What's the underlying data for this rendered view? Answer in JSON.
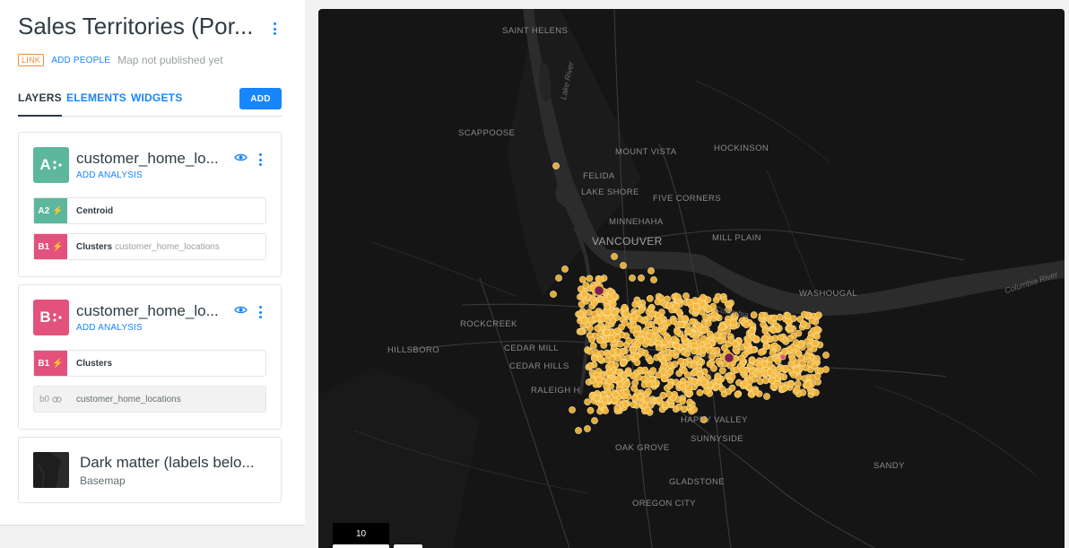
{
  "header": {
    "title": "Sales Territories (Por...",
    "link_badge": "LINK",
    "add_people": "ADD PEOPLE",
    "status": "Map not published yet"
  },
  "tabs": {
    "layers": "LAYERS",
    "elements": "ELEMENTS",
    "widgets": "WIDGETS",
    "add_button": "ADD"
  },
  "layers": [
    {
      "letter": "A",
      "name": "customer_home_lo...",
      "add_analysis": "ADD ANALYSIS",
      "color": "#5cb79d",
      "nodes": [
        {
          "id": "A2",
          "label": "Centroid",
          "source": "",
          "color": "#5cb79d"
        },
        {
          "id": "B1",
          "label": "Clusters",
          "source": "customer_home_locations",
          "color": "#e3517c"
        }
      ]
    },
    {
      "letter": "B",
      "name": "customer_home_lo...",
      "add_analysis": "ADD ANALYSIS",
      "color": "#e3517c",
      "nodes": [
        {
          "id": "B1",
          "label": "Clusters",
          "source": "",
          "color": "#e3517c"
        },
        {
          "id": "b0",
          "label": "customer_home_locations",
          "source": "",
          "color": ""
        }
      ]
    }
  ],
  "basemap": {
    "name": "Dark matter (labels belo...",
    "type": "Basemap"
  },
  "map": {
    "places": [
      "SAINT HELENS",
      "SCAPPOOSE",
      "MOUNT VISTA",
      "HOCKINSON",
      "FELIDA",
      "LAKE SHORE",
      "FIVE CORNERS",
      "MINNEHAHA",
      "VANCOUVER",
      "MILL PLAIN",
      "WASHOUGAL",
      "ROCKCREEK",
      "HILLSBORO",
      "CEDAR MILL",
      "CEDAR HILLS",
      "RALEIGH H",
      "HAPPY VALLEY",
      "SUNNYSIDE",
      "OAK GROVE",
      "GLADSTONE",
      "OREGON CITY",
      "SANDY"
    ],
    "water": [
      "Lake River",
      "Columbia River",
      "Columbia"
    ],
    "zoom": "10",
    "point_color": "#f5b83d",
    "centroid_color": "#7a1f5c",
    "highlight_color": "#d94fa0"
  }
}
